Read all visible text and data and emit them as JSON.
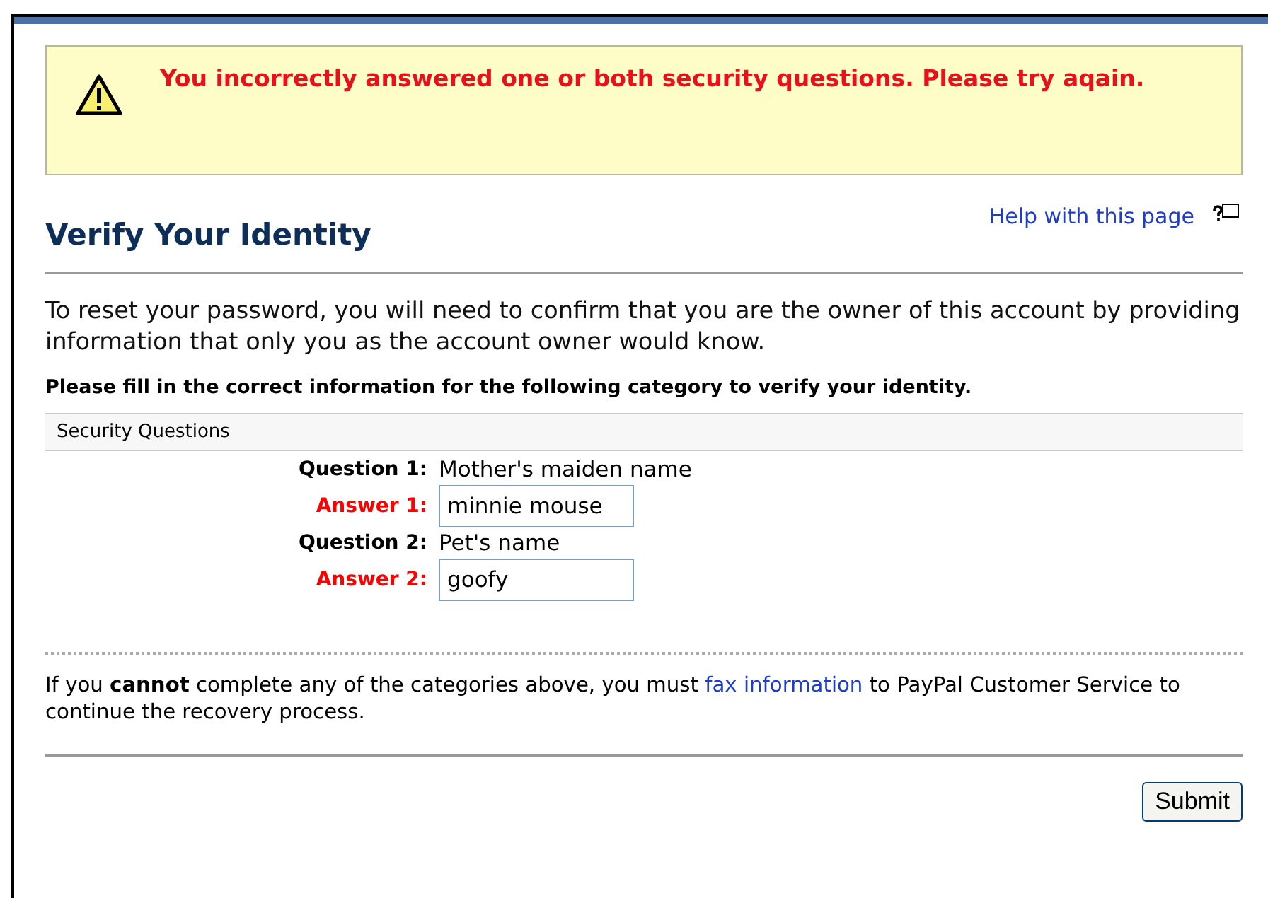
{
  "alert": {
    "message": "You incorrectly answered one or both security questions. Please try aqain."
  },
  "heading": "Verify Your Identity",
  "help_link": "Help with this page",
  "intro": "To reset your password, you will need to confirm that you are the owner of this account by providing information that only you as the account owner would know.",
  "instruction": "Please fill in the correct information for the following category to verify your identity.",
  "section": {
    "title": "Security Questions",
    "rows": [
      {
        "kind": "question",
        "label": "Question 1:",
        "value": "Mother's maiden name"
      },
      {
        "kind": "answer",
        "label": "Answer 1:",
        "value": "minnie mouse"
      },
      {
        "kind": "question",
        "label": "Question 2:",
        "value": "Pet's name"
      },
      {
        "kind": "answer",
        "label": "Answer 2:",
        "value": "goofy"
      }
    ]
  },
  "footer": {
    "before": "If you **cannot** complete any of the categories above, you must ",
    "link": "fax information",
    "after": " to PayPal Customer Service to continue the recovery process."
  },
  "buttons": [
    "Submit"
  ]
}
